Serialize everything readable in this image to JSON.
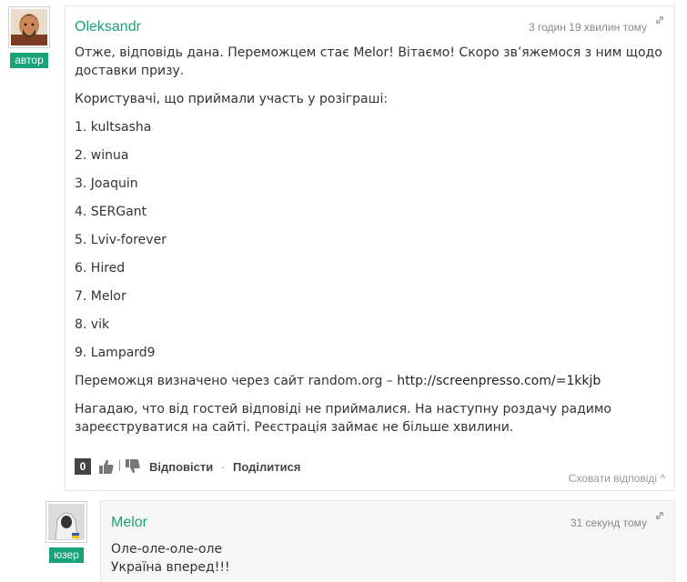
{
  "comments": [
    {
      "author": "Oleksandr",
      "badge": "автор",
      "time": "3 годин 19 хвилин тому",
      "paragraphs": [
        "Отже, відповідь дана. Переможцем стає Melor! Вітаємо! Скоро зв’яжемося з ним щодо доставки призу.",
        "Користувачі, що приймали участь у розіграші:",
        "1. kultsasha",
        "2. winua",
        "3. Joaquin",
        "4. SERGant",
        "5. Lviv-forever",
        "6. Hired",
        "7. Melor",
        "8. vik",
        "9. Lampard9"
      ],
      "winner_text": "Переможця визначено через сайт random.org – ",
      "winner_link": "http://screenpresso.com/=1kkjb",
      "last_paragraph": "Нагадаю, что від гостей відповіді не приймалися. На наступну роздачу радимо зареєструватися на сайті. Реєстрація займає не більше хвилини.",
      "vote_count": "0",
      "reply_label": "Відповісти",
      "share_label": "Поділитися",
      "separator": "·",
      "hide_replies_label": "Сховати відповіді ^",
      "link_icon": "link-icon",
      "like_icon": "thumbs-up-icon",
      "dislike_icon": "thumbs-down-icon"
    },
    {
      "author": "Melor",
      "badge": "юзер",
      "time": "31 секунд тому",
      "lines": [
        "Оле-оле-оле-оле",
        "Україна вперед!!!"
      ],
      "link_icon": "link-icon"
    }
  ],
  "colors": {
    "accent": "#1aa37a",
    "vote_bg": "#444444",
    "reply_bg": "#f6f6f6"
  }
}
